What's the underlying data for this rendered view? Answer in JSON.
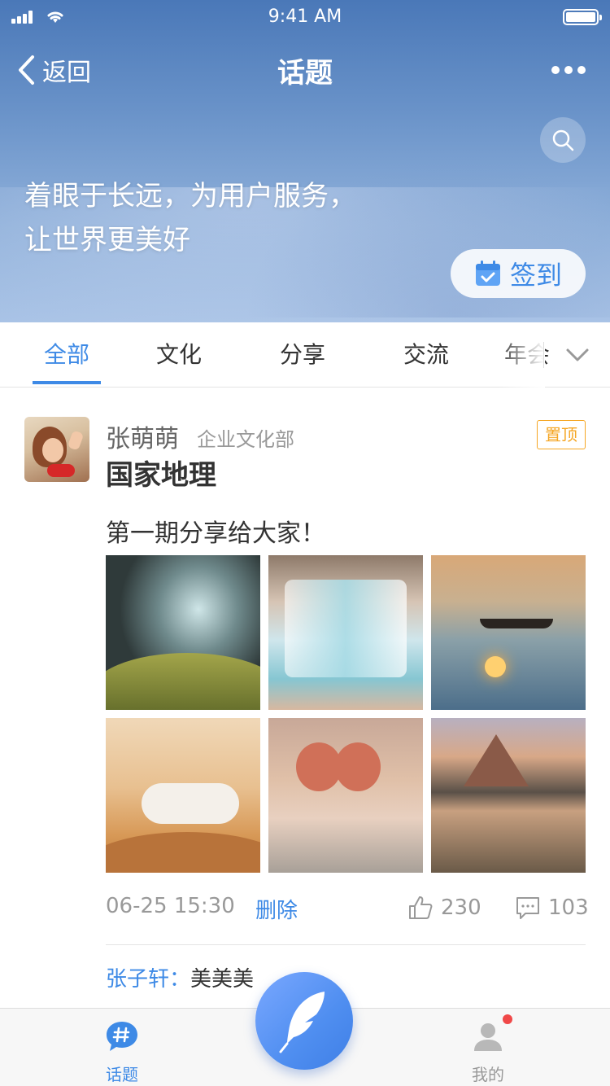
{
  "status_bar": {
    "time": "9:41 AM",
    "battery_level": 1.0
  },
  "nav": {
    "back_label": "返回",
    "title": "话题"
  },
  "banner": {
    "slogan_line1": "着眼于长远，为用户服务，",
    "slogan_line2": "让世界更美好",
    "checkin_label": "签到"
  },
  "tabs": {
    "items": [
      {
        "label": "全部"
      },
      {
        "label": "文化"
      },
      {
        "label": "分享"
      },
      {
        "label": "交流"
      },
      {
        "label": "年会"
      }
    ],
    "active_index": 0
  },
  "post": {
    "author": "张萌萌",
    "department": "企业文化部",
    "pinned_label": "置顶",
    "topic": "国家地理",
    "content": "第一期分享给大家！",
    "date": "06-25 15:30",
    "delete_label": "删除",
    "likes": "230",
    "comments_count": "103",
    "comments": [
      {
        "user": "张子轩：",
        "text": "美美美"
      }
    ]
  },
  "bottom_nav": {
    "left_label": "话题",
    "right_label": "我的",
    "has_notification": true
  },
  "colors": {
    "accent": "#3e8ae6",
    "pin": "#f5a623",
    "notification": "#f04848"
  },
  "icons": [
    "signal-icon",
    "wifi-icon",
    "battery-icon",
    "back-chevron-icon",
    "more-dots-icon",
    "search-icon",
    "calendar-check-icon",
    "chevron-down-icon",
    "thumbs-up-icon",
    "comment-icon",
    "hashtag-chat-icon",
    "user-icon",
    "feather-quill-icon"
  ]
}
